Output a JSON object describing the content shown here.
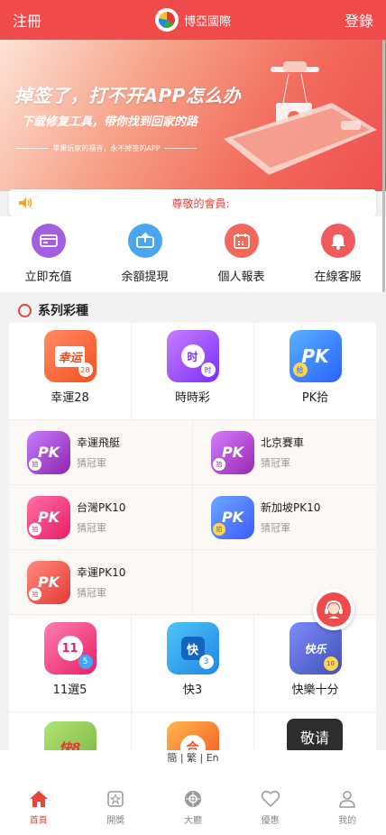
{
  "header": {
    "left_label": "注冊",
    "brand_name": "博亞國際",
    "right_label": "登錄"
  },
  "banner": {
    "headline": "掉签了，打不开APP怎么办",
    "subline": "下载修复工具，带你找到回家的路",
    "tagline": "苹果玩家的福音，永不掉签的APP"
  },
  "notice": {
    "text": "尊敬的會員:"
  },
  "quick_actions": [
    {
      "label": "立即充值",
      "icon": "card-icon",
      "color": "#a25fe0"
    },
    {
      "label": "余額提現",
      "icon": "withdraw-icon",
      "color": "#4aa6ef"
    },
    {
      "label": "個人報表",
      "icon": "calendar-icon",
      "color": "#f0695a"
    },
    {
      "label": "在線客服",
      "icon": "bell-icon",
      "color": "#f05a5a"
    }
  ],
  "section": {
    "title": "系列彩種"
  },
  "games_top": [
    {
      "label": "幸運28",
      "glyph": "幸运",
      "badge": "28"
    },
    {
      "label": "時時彩",
      "glyph": "时",
      "badge": "时"
    },
    {
      "label": "PK拾",
      "glyph": "PK",
      "badge": "拾"
    }
  ],
  "games_pk": [
    {
      "name": "幸運飛艇",
      "sub": "猜冠軍"
    },
    {
      "name": "北京賽車",
      "sub": "猜冠軍"
    },
    {
      "name": "台灣PK10",
      "sub": "猜冠軍"
    },
    {
      "name": "新加坡PK10",
      "sub": "猜冠軍"
    },
    {
      "name": "幸運PK10",
      "sub": "猜冠軍"
    }
  ],
  "games_mid": [
    {
      "label": "11選5",
      "glyph": "11",
      "badge": "5"
    },
    {
      "label": "快3",
      "glyph": "快",
      "badge": "3"
    },
    {
      "label": "快樂十分",
      "glyph": "快乐",
      "badge": "10"
    }
  ],
  "games_bottom": [
    {
      "glyph": "快8"
    },
    {
      "glyph": "合"
    }
  ],
  "pk_icon": {
    "glyph": "PK",
    "badge": "拾"
  },
  "inquire_label": "敬请",
  "lang": "簡 | 繁 | En",
  "tabs": [
    {
      "label": "首頁",
      "icon": "home-icon",
      "active": true
    },
    {
      "label": "開獎",
      "icon": "lottery-draw-icon",
      "active": false
    },
    {
      "label": "大廳",
      "icon": "lobby-icon",
      "active": false
    },
    {
      "label": "優惠",
      "icon": "heart-icon",
      "active": false
    },
    {
      "label": "我的",
      "icon": "user-icon",
      "active": false
    }
  ]
}
